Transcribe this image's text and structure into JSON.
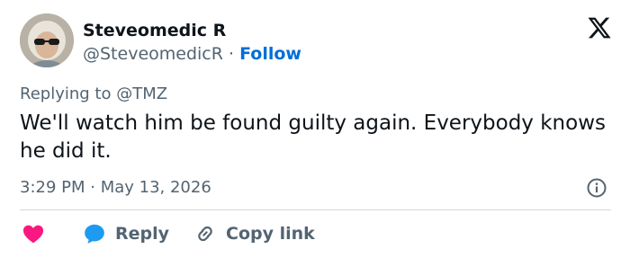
{
  "author": {
    "display_name": "Steveomedic R",
    "handle": "@SteveomedicR",
    "separator": "·",
    "follow_label": "Follow"
  },
  "platform_icon": "x-logo-icon",
  "reply_context": "Replying to @TMZ",
  "tweet_text": "We'll watch him be found guilty again. Everybody knows he did it.",
  "timestamp": "3:29 PM · May 13, 2026",
  "actions": {
    "like_icon": "heart-icon",
    "reply_label": "Reply",
    "copy_label": "Copy link"
  },
  "colors": {
    "text": "#0f1419",
    "secondary": "#536471",
    "link": "#006fd6",
    "like": "#f91880",
    "reply": "#1d9bf0",
    "divider": "#cfd9de"
  }
}
